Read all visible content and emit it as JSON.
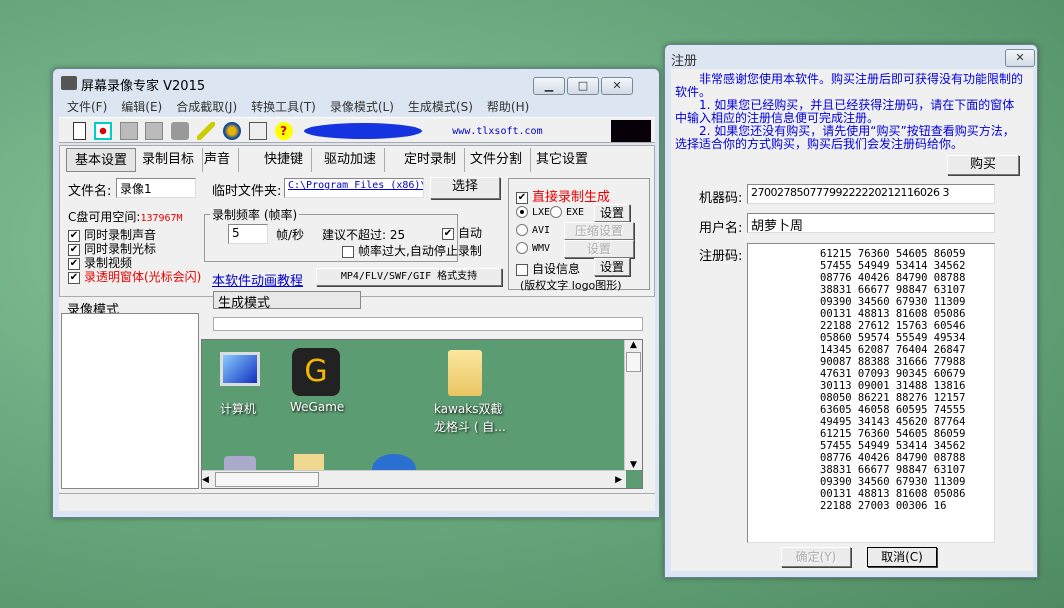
{
  "main": {
    "title": "屏幕录像专家 V2015",
    "menu": [
      "文件(F)",
      "编辑(E)",
      "合成截取(J)",
      "转换工具(T)",
      "录像模式(L)",
      "生成模式(S)",
      "帮助(H)"
    ],
    "website": "www.tlxsoft.com",
    "tabs": [
      "基本设置",
      "录制目标",
      "声音",
      "快捷键",
      "驱动加速",
      "定时录制",
      "文件分割",
      "其它设置"
    ],
    "filename_label": "文件名:",
    "filename": "录像1",
    "tempdir_label": "临时文件夹:",
    "tempdir": "C:\\Program Files (x86)\\",
    "choose": "选择",
    "disk_label": "C盘可用空间:",
    "disk_value": "137967M",
    "checks": [
      "同时录制声音",
      "同时录制光标",
      "录制视频",
      "录透明窗体(光标会闪)"
    ],
    "tutorial": "本软件动画教程",
    "fps_group": "录制频率 (帧率)",
    "fps": "5",
    "fps_unit": "帧/秒",
    "fps_hint": "建议不超过: 25",
    "auto": "自动",
    "auto_stop": "帧率过大,自动停止录制",
    "formats": "MP4/FLV/SWF/GIF  格式支持",
    "direct": "直接录制生成",
    "lxe": "LXE",
    "exe": "EXE",
    "avi": "AVI",
    "wmv": "WMV",
    "settings": "设置",
    "compress": "压缩设置",
    "custom_info": "自设信息",
    "custom_note": "(版权文字 logo图形)",
    "pane_left": "录像模式",
    "pane_right": "生成模式",
    "desktop_icons": [
      "计算机",
      "WeGame",
      "kawaks双截",
      "龙格斗 ( 自..."
    ]
  },
  "reg": {
    "title": "注册",
    "intro": "非常感谢您使用本软件。购买注册后即可获得没有功能限制的软件。",
    "p1": "1. 如果您已经购买，并且已经获得注册码，请在下面的窗体中输入相应的注册信息便可完成注册。",
    "p2": "2. 如果您还没有购买，请先使用“购买”按钮查看购买方法，选择适合你的方式购买，购买后我们会发注册码给你。",
    "buy": "购买",
    "machine_label": "机器码:",
    "machine": "27002785077799222220212116026 3",
    "user_label": "用户名:",
    "user": "胡萝卜周",
    "code_label": "注册码:",
    "code_lines": [
      "61215 76360 54605 86059",
      "57455 54949 53414 34562",
      "08776 40426 84790 08788",
      "38831 66677 98847 63107",
      "09390 34560 67930 11309",
      "00131 48813 81608 05086",
      "22188 27612 15763 60546",
      "05860 59574 55549 49534",
      "14345 62087 76404 26847",
      "90087 88388 31666 77988",
      "47631 07093 90345 60679",
      "30113 09001 31488 13816",
      "08050 86221 88276 12157",
      "63605 46058 60595 74555",
      "49495 34143 45620 87764",
      "61215 76360 54605 86059",
      "57455 54949 53414 34562",
      "08776 40426 84790 08788",
      "38831 66677 98847 63107",
      "09390 34560 67930 11309",
      "00131 48813 81608 05086",
      "22188 27003 00306 16"
    ],
    "ok": "确定(Y)",
    "cancel": "取消(C)"
  }
}
